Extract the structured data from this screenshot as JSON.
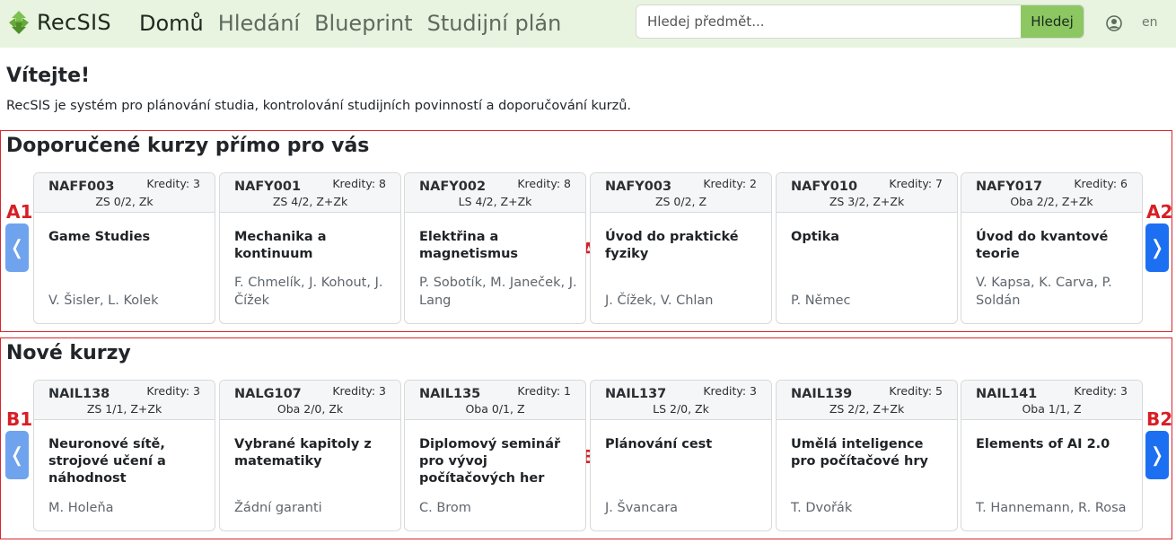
{
  "app": {
    "name": "RecSIS"
  },
  "nav": {
    "items": [
      "Domů",
      "Hledání",
      "Blueprint",
      "Studijní plán"
    ]
  },
  "search": {
    "placeholder": "Hledej předmět...",
    "button_label": "Hledej"
  },
  "header": {
    "user_icon": "user-circle-icon",
    "lang": "en"
  },
  "welcome": {
    "title": "Vítejte!",
    "text": "RecSIS je systém pro plánování studia, kontrolování studijních povinností a doporučování kurzů."
  },
  "sections": [
    {
      "title": "Doporučené kurzy přímo pro vás",
      "markers": {
        "left": "A1",
        "right": "A2",
        "center": "A"
      },
      "prev_label": "❬",
      "next_label": "❭",
      "cards": [
        {
          "code": "NAFF003",
          "credits": "Kredity: 3",
          "semester": "ZS 0/2, Zk",
          "name": "Game Studies",
          "guarantors": "V. Šisler, L. Kolek"
        },
        {
          "code": "NAFY001",
          "credits": "Kredity: 8",
          "semester": "ZS 4/2, Z+Zk",
          "name": "Mechanika a kontinuum",
          "guarantors": "F. Chmelík, J. Kohout, J. Čížek"
        },
        {
          "code": "NAFY002",
          "credits": "Kredity: 8",
          "semester": "LS 4/2, Z+Zk",
          "name": "Elektřina a magnetismus",
          "guarantors": "P. Sobotík, M. Janeček, J. Lang"
        },
        {
          "code": "NAFY003",
          "credits": "Kredity: 2",
          "semester": "ZS 0/2, Z",
          "name": "Úvod do praktické fyziky",
          "guarantors": "J. Čížek, V. Chlan"
        },
        {
          "code": "NAFY010",
          "credits": "Kredity: 7",
          "semester": "ZS 3/2, Z+Zk",
          "name": "Optika",
          "guarantors": "P. Němec"
        },
        {
          "code": "NAFY017",
          "credits": "Kredity: 6",
          "semester": "Oba 2/2, Z+Zk",
          "name": "Úvod do kvantové teorie",
          "guarantors": "V. Kapsa, K. Carva, P. Soldán"
        }
      ]
    },
    {
      "title": "Nové kurzy",
      "markers": {
        "left": "B1",
        "right": "B2",
        "center": "B"
      },
      "prev_label": "❬",
      "next_label": "❭",
      "cards": [
        {
          "code": "NAIL138",
          "credits": "Kredity: 3",
          "semester": "ZS 1/1, Z+Zk",
          "name": "Neuronové sítě, strojové učení a náhodnost",
          "guarantors": "M. Holeňa"
        },
        {
          "code": "NALG107",
          "credits": "Kredity: 3",
          "semester": "Oba 2/0, Zk",
          "name": "Vybrané kapitoly z matematiky",
          "guarantors": "Žádní garanti"
        },
        {
          "code": "NAIL135",
          "credits": "Kredity: 1",
          "semester": "Oba 0/1, Z",
          "name": "Diplomový seminář pro vývoj počítačových her",
          "guarantors": "C. Brom"
        },
        {
          "code": "NAIL137",
          "credits": "Kredity: 3",
          "semester": "LS 2/0, Zk",
          "name": "Plánování cest",
          "guarantors": "J. Švancara"
        },
        {
          "code": "NAIL139",
          "credits": "Kredity: 5",
          "semester": "ZS 2/2, Z+Zk",
          "name": "Umělá inteligence pro počítačové hry",
          "guarantors": "T. Dvořák"
        },
        {
          "code": "NAIL141",
          "credits": "Kredity: 3",
          "semester": "Oba 1/1, Z",
          "name": "Elements of AI 2.0",
          "guarantors": "T. Hannemann, R. Rosa"
        }
      ]
    }
  ],
  "colors": {
    "navbar_bg": "#e8f4df",
    "search_button": "#8cc762",
    "carousel_next": "#1d6ff2",
    "carousel_prev": "#6fa3ee",
    "annotation_red": "#d81e25"
  }
}
